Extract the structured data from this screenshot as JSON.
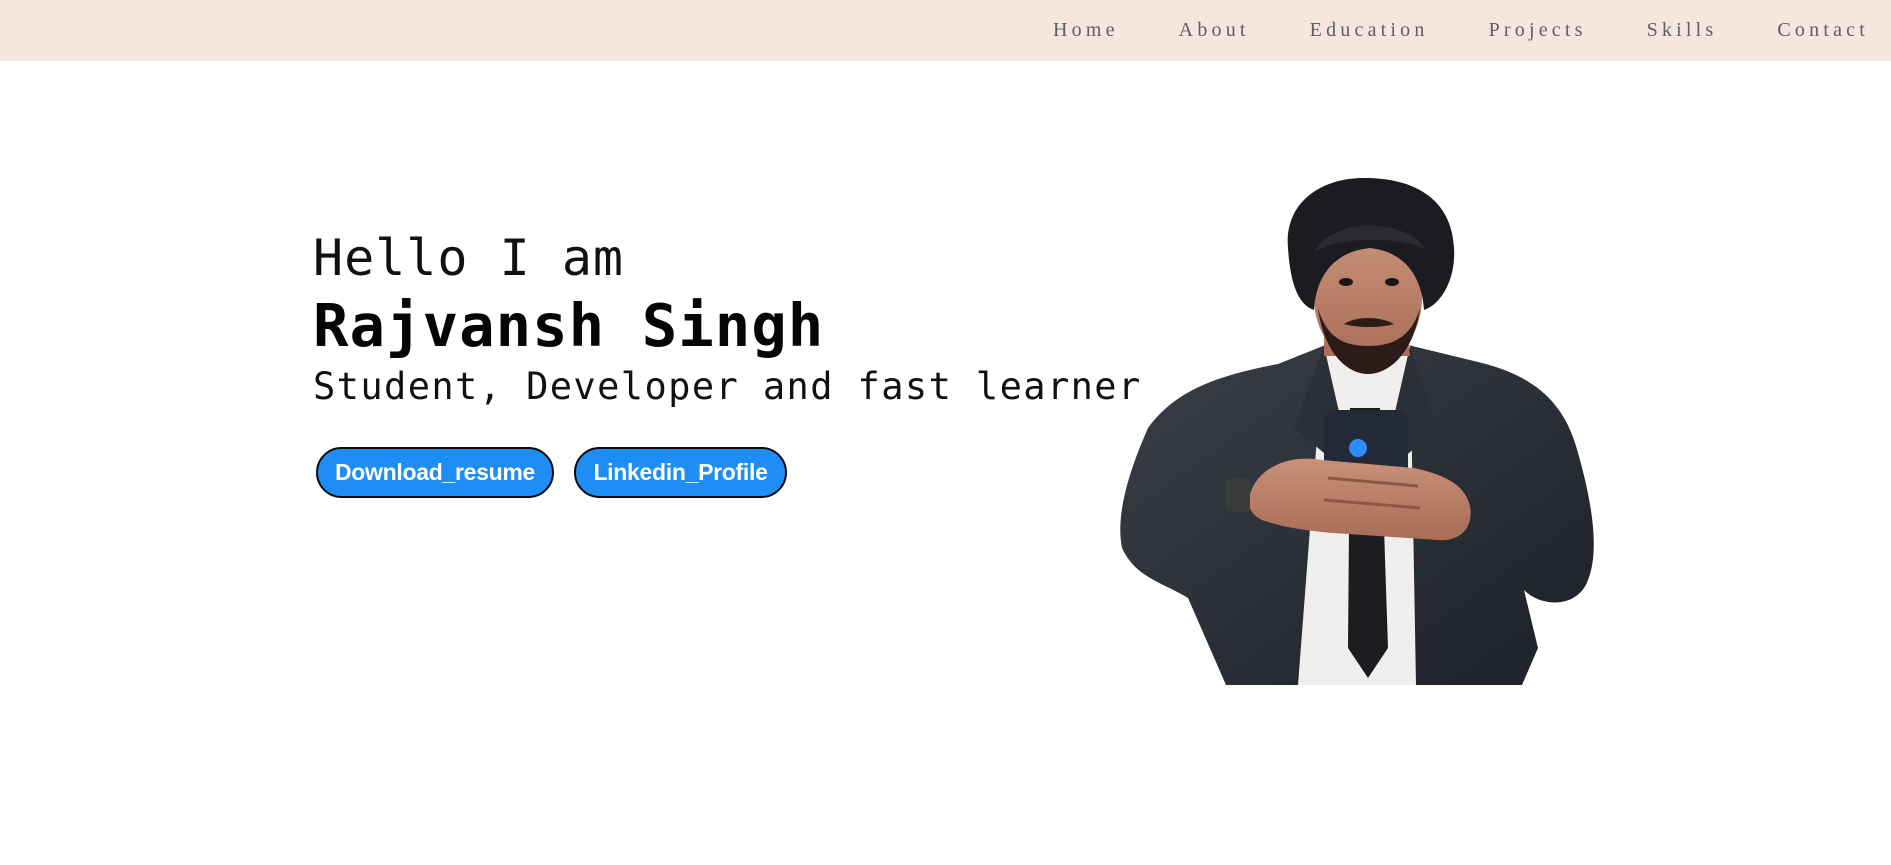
{
  "nav": {
    "items": [
      {
        "label": "Home"
      },
      {
        "label": "About"
      },
      {
        "label": "Education"
      },
      {
        "label": "Projects"
      },
      {
        "label": "Skills"
      },
      {
        "label": "Contact"
      }
    ]
  },
  "hero": {
    "greeting": "Hello I am",
    "name": "Rajvansh Singh",
    "tagline": "Student, Developer and fast learner",
    "buttons": {
      "resume_label": "Download_resume",
      "linkedin_label": "Linkedin_Profile"
    }
  },
  "colors": {
    "nav_background": "#f6e6de",
    "nav_text": "#5f5f5f",
    "button_background": "#1e8df5",
    "button_border": "#0a0a0a"
  }
}
